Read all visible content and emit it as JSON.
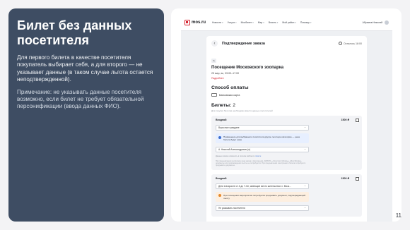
{
  "slide": {
    "title": "Билет без данных посетителя",
    "para": "Для первого билета в качестве посетителя покупатель выбирает себя, а для второго — не указывает данные (в таком случае льгота остается неподтвержденной).",
    "note": "Примечание: не указывать данные посетителя возможно, если билет не требует обязательной персонификации (ввода данных ФИО).",
    "page_number": "11"
  },
  "site": {
    "logo": "mos.ru",
    "nav": [
      "Новости",
      "Услуги",
      "Мосбилет",
      "Мэр",
      "Власть",
      "Мой район",
      "Помощь"
    ],
    "user": "Абрамов Николай"
  },
  "order": {
    "title": "Подтверждение заказа",
    "timer": "Осталось 18:00",
    "tag": "0+",
    "event_title": "Посещение Московского зоопарка",
    "event_date": "25 мар, вс, 09:00–17:00",
    "details_link": "Подробнее",
    "payment_heading": "Способ оплаты",
    "payment_method": "Банковская карта",
    "tickets_heading": "Билеты:",
    "tickets_count": "2",
    "tickets_hint": "Для покупки билетов необходимо ввести данные посетителей"
  },
  "ticket1": {
    "label": "Входной",
    "price": "1500 ₽",
    "category": "Взрослые граждане",
    "alert": "Применение для выбранного посетителя другую льготную категорию — цена билета будет ниже",
    "visitor": "А. Николай Александрович (я)",
    "hint_text": "Данные можно изменить в личном кабинете",
    "hint_link": "mos.ru",
    "small_print": "При предъявлении контролеру кода заказа в приложении «МОБ.Ю» «Госуслуги Москвы» «Моя Москва» документы для подтверждения льготы не потребуются. При предъявлении электронного билета потребуется предъявить документы."
  },
  "ticket2": {
    "label": "Входной",
    "price": "1500 ₽",
    "category": "Дети в возрасте от 4 до 7 лет, имеющие место жительства в г. Моск...",
    "alert": "При посещении мероприятия потребуется предъявить документ, подтверждающий льготу",
    "visitor": "Не указывать посетителя"
  }
}
